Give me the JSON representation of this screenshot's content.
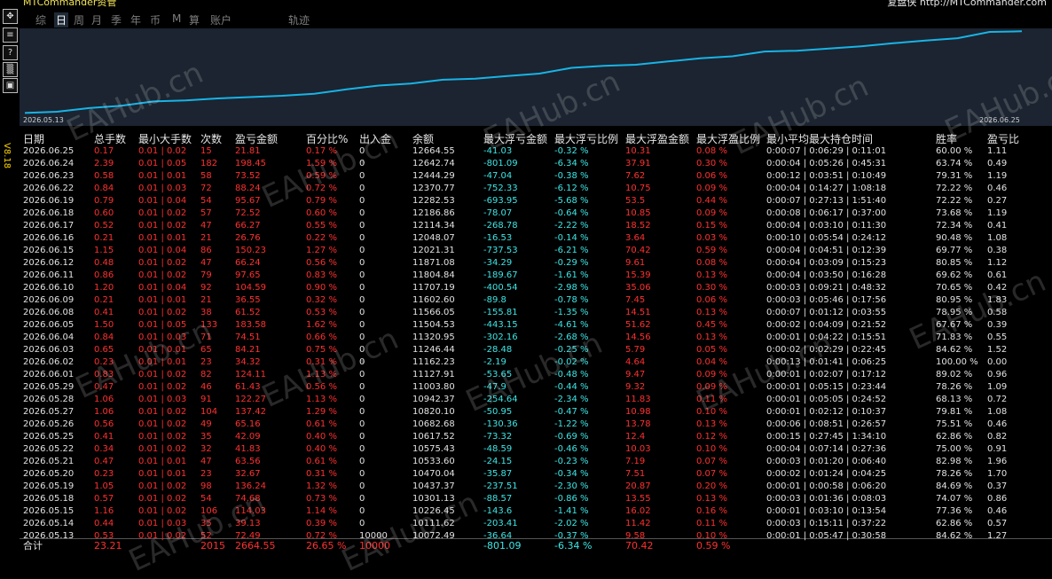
{
  "app": {
    "title": "MTCommander资管",
    "site": "复盘侠 http://MTCommander.com",
    "version": "V8.18"
  },
  "tools": [
    {
      "icon": "move-icon",
      "glyph": "✥"
    },
    {
      "icon": "doc-icon",
      "glyph": "≡"
    },
    {
      "icon": "help-icon",
      "glyph": "?"
    },
    {
      "icon": "doc2-icon",
      "glyph": "▒"
    },
    {
      "icon": "window-icon",
      "glyph": "▣"
    }
  ],
  "tabs": [
    {
      "label": "综",
      "active": false
    },
    {
      "label": "日",
      "active": true
    },
    {
      "label": "周",
      "active": false
    },
    {
      "label": "月",
      "active": false
    },
    {
      "label": "季",
      "active": false
    },
    {
      "label": "年",
      "active": false
    },
    {
      "label": "币",
      "active": false
    },
    {
      "label": "M",
      "active": false
    },
    {
      "label": "算",
      "active": false
    },
    {
      "label": "账户",
      "active": false
    },
    {
      "label": "轨迹",
      "active": false
    }
  ],
  "chart": {
    "start_date": "2026.05.13",
    "end_date": "2026.06.25",
    "line_color": "#19b3e6",
    "bg_color": "#1b2430"
  },
  "chart_data": {
    "type": "line",
    "x": [
      "2026.05.13",
      "2026.05.14",
      "2026.05.15",
      "2026.05.18",
      "2026.05.19",
      "2026.05.20",
      "2026.05.21",
      "2026.05.22",
      "2026.05.25",
      "2026.05.26",
      "2026.05.27",
      "2026.05.28",
      "2026.05.29",
      "2026.06.01",
      "2026.06.02",
      "2026.06.03",
      "2026.06.04",
      "2026.06.05",
      "2026.06.08",
      "2026.06.09",
      "2026.06.10",
      "2026.06.11",
      "2026.06.12",
      "2026.06.15",
      "2026.06.16",
      "2026.06.17",
      "2026.06.18",
      "2026.06.19",
      "2026.06.22",
      "2026.06.23",
      "2026.06.24",
      "2026.06.25"
    ],
    "series": [
      {
        "values": [
          10072.49,
          10111.62,
          10226.45,
          10301.13,
          10437.37,
          10470.04,
          10533.6,
          10575.43,
          10617.52,
          10682.68,
          10820.1,
          10942.37,
          11003.8,
          11127.91,
          11162.23,
          11246.44,
          11320.95,
          11504.53,
          11566.05,
          11602.6,
          11707.19,
          11804.84,
          11871.08,
          12021.31,
          12048.07,
          12114.34,
          12186.86,
          12282.53,
          12370.77,
          12444.29,
          12642.74,
          12664.55
        ]
      }
    ]
  },
  "headers": [
    "日期",
    "总手数",
    "最小大手数",
    "次数",
    "盈亏金额",
    "百分比%",
    "出入金",
    "余额",
    "最大浮亏金额",
    "最大浮亏比例",
    "最大浮盈金额",
    "最大浮盈比例",
    "最小平均最大持仓时间",
    "胜率",
    "盈亏比"
  ],
  "rows": [
    [
      "2026.06.25",
      "0.17",
      "0.01 | 0.02",
      "15",
      "21.81",
      "0.17 %",
      "0",
      "12664.55",
      "-41.03",
      "-0.32 %",
      "10.31",
      "0.08 %",
      "0:00:07 | 0:06:29 | 0:11:01",
      "60.00 %",
      "1.11"
    ],
    [
      "2026.06.24",
      "2.39",
      "0.01 | 0.05",
      "182",
      "198.45",
      "1.59 %",
      "0",
      "12642.74",
      "-801.09",
      "-6.34 %",
      "37.91",
      "0.30 %",
      "0:00:04 | 0:05:26 | 0:45:31",
      "63.74 %",
      "0.49"
    ],
    [
      "2026.06.23",
      "0.58",
      "0.01 | 0.01",
      "58",
      "73.52",
      "0.59 %",
      "0",
      "12444.29",
      "-47.04",
      "-0.38 %",
      "7.62",
      "0.06 %",
      "0:00:12 | 0:03:51 | 0:10:49",
      "79.31 %",
      "1.19"
    ],
    [
      "2026.06.22",
      "0.84",
      "0.01 | 0.03",
      "72",
      "88.24",
      "0.72 %",
      "0",
      "12370.77",
      "-752.33",
      "-6.12 %",
      "10.75",
      "0.09 %",
      "0:00:04 | 0:14:27 | 1:08:18",
      "72.22 %",
      "0.46"
    ],
    [
      "2026.06.19",
      "0.79",
      "0.01 | 0.04",
      "54",
      "95.67",
      "0.79 %",
      "0",
      "12282.53",
      "-693.95",
      "-5.68 %",
      "53.5",
      "0.44 %",
      "0:00:07 | 0:27:13 | 1:51:40",
      "72.22 %",
      "0.27"
    ],
    [
      "2026.06.18",
      "0.60",
      "0.01 | 0.02",
      "57",
      "72.52",
      "0.60 %",
      "0",
      "12186.86",
      "-78.07",
      "-0.64 %",
      "10.85",
      "0.09 %",
      "0:00:08 | 0:06:17 | 0:37:00",
      "73.68 %",
      "1.19"
    ],
    [
      "2026.06.17",
      "0.52",
      "0.01 | 0.02",
      "47",
      "66.27",
      "0.55 %",
      "0",
      "12114.34",
      "-268.78",
      "-2.22 %",
      "18.52",
      "0.15 %",
      "0:00:04 | 0:03:10 | 0:11:30",
      "72.34 %",
      "0.41"
    ],
    [
      "2026.06.16",
      "0.21",
      "0.01 | 0.01",
      "21",
      "26.76",
      "0.22 %",
      "0",
      "12048.07",
      "-16.53",
      "-0.14 %",
      "3.64",
      "0.03 %",
      "0:00:10 | 0:05:54 | 0:24:12",
      "90.48 %",
      "1.08"
    ],
    [
      "2026.06.15",
      "1.15",
      "0.01 | 0.04",
      "86",
      "150.23",
      "1.27 %",
      "0",
      "12021.31",
      "-737.53",
      "-6.21 %",
      "70.42",
      "0.59 %",
      "0:00:04 | 0:04:51 | 0:12:39",
      "69.77 %",
      "0.38"
    ],
    [
      "2026.06.12",
      "0.48",
      "0.01 | 0.02",
      "47",
      "66.24",
      "0.56 %",
      "0",
      "11871.08",
      "-34.29",
      "-0.29 %",
      "9.61",
      "0.08 %",
      "0:00:04 | 0:03:09 | 0:15:23",
      "80.85 %",
      "1.12"
    ],
    [
      "2026.06.11",
      "0.86",
      "0.01 | 0.02",
      "79",
      "97.65",
      "0.83 %",
      "0",
      "11804.84",
      "-189.67",
      "-1.61 %",
      "15.39",
      "0.13 %",
      "0:00:04 | 0:03:50 | 0:16:28",
      "69.62 %",
      "0.61"
    ],
    [
      "2026.06.10",
      "1.20",
      "0.01 | 0.04",
      "92",
      "104.59",
      "0.90 %",
      "0",
      "11707.19",
      "-400.54",
      "-2.98 %",
      "35.06",
      "0.30 %",
      "0:00:03 | 0:09:21 | 0:48:32",
      "70.65 %",
      "0.42"
    ],
    [
      "2026.06.09",
      "0.21",
      "0.01 | 0.01",
      "21",
      "36.55",
      "0.32 %",
      "0",
      "11602.60",
      "-89.8",
      "-0.78 %",
      "7.45",
      "0.06 %",
      "0:00:03 | 0:05:46 | 0:17:56",
      "80.95 %",
      "1.83"
    ],
    [
      "2026.06.08",
      "0.41",
      "0.01 | 0.02",
      "38",
      "61.52",
      "0.53 %",
      "0",
      "11566.05",
      "-155.81",
      "-1.35 %",
      "14.51",
      "0.13 %",
      "0:00:07 | 0:01:12 | 0:03:55",
      "78.95 %",
      "0.58"
    ],
    [
      "2026.06.05",
      "1.50",
      "0.01 | 0.05",
      "133",
      "183.58",
      "1.62 %",
      "0",
      "11504.53",
      "-443.15",
      "-4.61 %",
      "51.62",
      "0.45 %",
      "0:00:02 | 0:04:09 | 0:21:52",
      "67.67 %",
      "0.39"
    ],
    [
      "2026.06.04",
      "0.84",
      "0.01 | 0.03",
      "71",
      "74.51",
      "0.66 %",
      "0",
      "11320.95",
      "-302.16",
      "-2.68 %",
      "14.56",
      "0.13 %",
      "0:00:01 | 0:04:22 | 0:15:51",
      "71.83 %",
      "0.55"
    ],
    [
      "2026.06.03",
      "0.65",
      "0.01 | 0.01",
      "65",
      "84.21",
      "0.75 %",
      "0",
      "11246.44",
      "-28.48",
      "-0.25 %",
      "5.79",
      "0.05 %",
      "0:00:02 | 0:02:29 | 0:22:45",
      "84.62 %",
      "1.52"
    ],
    [
      "2026.06.02",
      "0.23",
      "0.01 | 0.01",
      "23",
      "34.32",
      "0.31 %",
      "0",
      "11162.23",
      "-2.19",
      "-0.02 %",
      "4.64",
      "0.04 %",
      "0:00:13 | 0:01:41 | 0:06:25",
      "100.00 %",
      "0.00"
    ],
    [
      "2026.06.01",
      "0.83",
      "0.01 | 0.02",
      "82",
      "124.11",
      "1.13 %",
      "0",
      "11127.91",
      "-53.65",
      "-0.48 %",
      "9.47",
      "0.09 %",
      "0:00:01 | 0:02:07 | 0:17:12",
      "89.02 %",
      "0.96"
    ],
    [
      "2026.05.29",
      "0.47",
      "0.01 | 0.02",
      "46",
      "61.43",
      "0.56 %",
      "0",
      "11003.80",
      "-47.9",
      "-0.44 %",
      "9.32",
      "0.09 %",
      "0:00:01 | 0:05:15 | 0:23:44",
      "78.26 %",
      "1.09"
    ],
    [
      "2026.05.28",
      "1.06",
      "0.01 | 0.03",
      "91",
      "122.27",
      "1.13 %",
      "0",
      "10942.37",
      "-254.64",
      "-2.34 %",
      "11.83",
      "0.11 %",
      "0:00:01 | 0:05:05 | 0:24:52",
      "68.13 %",
      "0.72"
    ],
    [
      "2026.05.27",
      "1.06",
      "0.01 | 0.02",
      "104",
      "137.42",
      "1.29 %",
      "0",
      "10820.10",
      "-50.95",
      "-0.47 %",
      "10.98",
      "0.10 %",
      "0:00:01 | 0:02:12 | 0:10:37",
      "79.81 %",
      "1.08"
    ],
    [
      "2026.05.26",
      "0.56",
      "0.01 | 0.02",
      "49",
      "65.16",
      "0.61 %",
      "0",
      "10682.68",
      "-130.36",
      "-1.22 %",
      "13.78",
      "0.13 %",
      "0:00:06 | 0:08:51 | 0:26:57",
      "75.51 %",
      "0.46"
    ],
    [
      "2026.05.25",
      "0.41",
      "0.01 | 0.02",
      "35",
      "42.09",
      "0.40 %",
      "0",
      "10617.52",
      "-73.32",
      "-0.69 %",
      "12.4",
      "0.12 %",
      "0:00:15 | 0:27:45 | 1:34:10",
      "62.86 %",
      "0.82"
    ],
    [
      "2026.05.22",
      "0.34",
      "0.01 | 0.02",
      "32",
      "41.83",
      "0.40 %",
      "0",
      "10575.43",
      "-48.59",
      "-0.46 %",
      "10.03",
      "0.10 %",
      "0:00:04 | 0:07:14 | 0:27:36",
      "75.00 %",
      "0.91"
    ],
    [
      "2026.05.21",
      "0.47",
      "0.01 | 0.01",
      "47",
      "63.56",
      "0.61 %",
      "0",
      "10533.60",
      "-24.15",
      "-0.23 %",
      "7.19",
      "0.07 %",
      "0:00:03 | 0:01:20 | 0:06:40",
      "82.98 %",
      "1.96"
    ],
    [
      "2026.05.20",
      "0.23",
      "0.01 | 0.01",
      "23",
      "32.67",
      "0.31 %",
      "0",
      "10470.04",
      "-35.87",
      "-0.34 %",
      "7.51",
      "0.07 %",
      "0:00:02 | 0:01:24 | 0:04:25",
      "78.26 %",
      "1.70"
    ],
    [
      "2026.05.19",
      "1.05",
      "0.01 | 0.02",
      "98",
      "136.24",
      "1.32 %",
      "0",
      "10437.37",
      "-237.51",
      "-2.30 %",
      "20.87",
      "0.20 %",
      "0:00:01 | 0:00:58 | 0:06:20",
      "84.69 %",
      "0.37"
    ],
    [
      "2026.05.18",
      "0.57",
      "0.01 | 0.02",
      "54",
      "74.68",
      "0.73 %",
      "0",
      "10301.13",
      "-88.57",
      "-0.86 %",
      "13.55",
      "0.13 %",
      "0:00:03 | 0:01:36 | 0:08:03",
      "74.07 %",
      "0.86"
    ],
    [
      "2026.05.15",
      "1.16",
      "0.01 | 0.02",
      "106",
      "114.03",
      "1.14 %",
      "0",
      "10226.45",
      "-143.6",
      "-1.41 %",
      "16.02",
      "0.16 %",
      "0:00:01 | 0:03:10 | 0:13:54",
      "77.36 %",
      "0.46"
    ],
    [
      "2026.05.14",
      "0.44",
      "0.01 | 0.03",
      "35",
      "39.13",
      "0.39 %",
      "0",
      "10111.62",
      "-203.41",
      "-2.02 %",
      "11.42",
      "0.11 %",
      "0:00:03 | 0:15:11 | 0:37:22",
      "62.86 %",
      "0.57"
    ],
    [
      "2026.05.13",
      "0.53",
      "0.01 | 0.02",
      "52",
      "72.49",
      "0.72 %",
      "10000",
      "10072.49",
      "-36.64",
      "-0.37 %",
      "9.58",
      "0.10 %",
      "0:00:01 | 0:05:47 | 0:30:58",
      "84.62 %",
      "1.27"
    ]
  ],
  "total": [
    "合计",
    "23.21",
    "",
    "2015",
    "2664.55",
    "26.65 %",
    "10000",
    "",
    "-801.09",
    "-6.34 %",
    "70.42",
    "0.59 %",
    "",
    "",
    ""
  ],
  "watermark": "EAHub.cn",
  "colors": {
    "red": "#ff3030",
    "cyan": "#3de6e6",
    "yellow": "#ffd400",
    "line": "#19b3e6"
  }
}
